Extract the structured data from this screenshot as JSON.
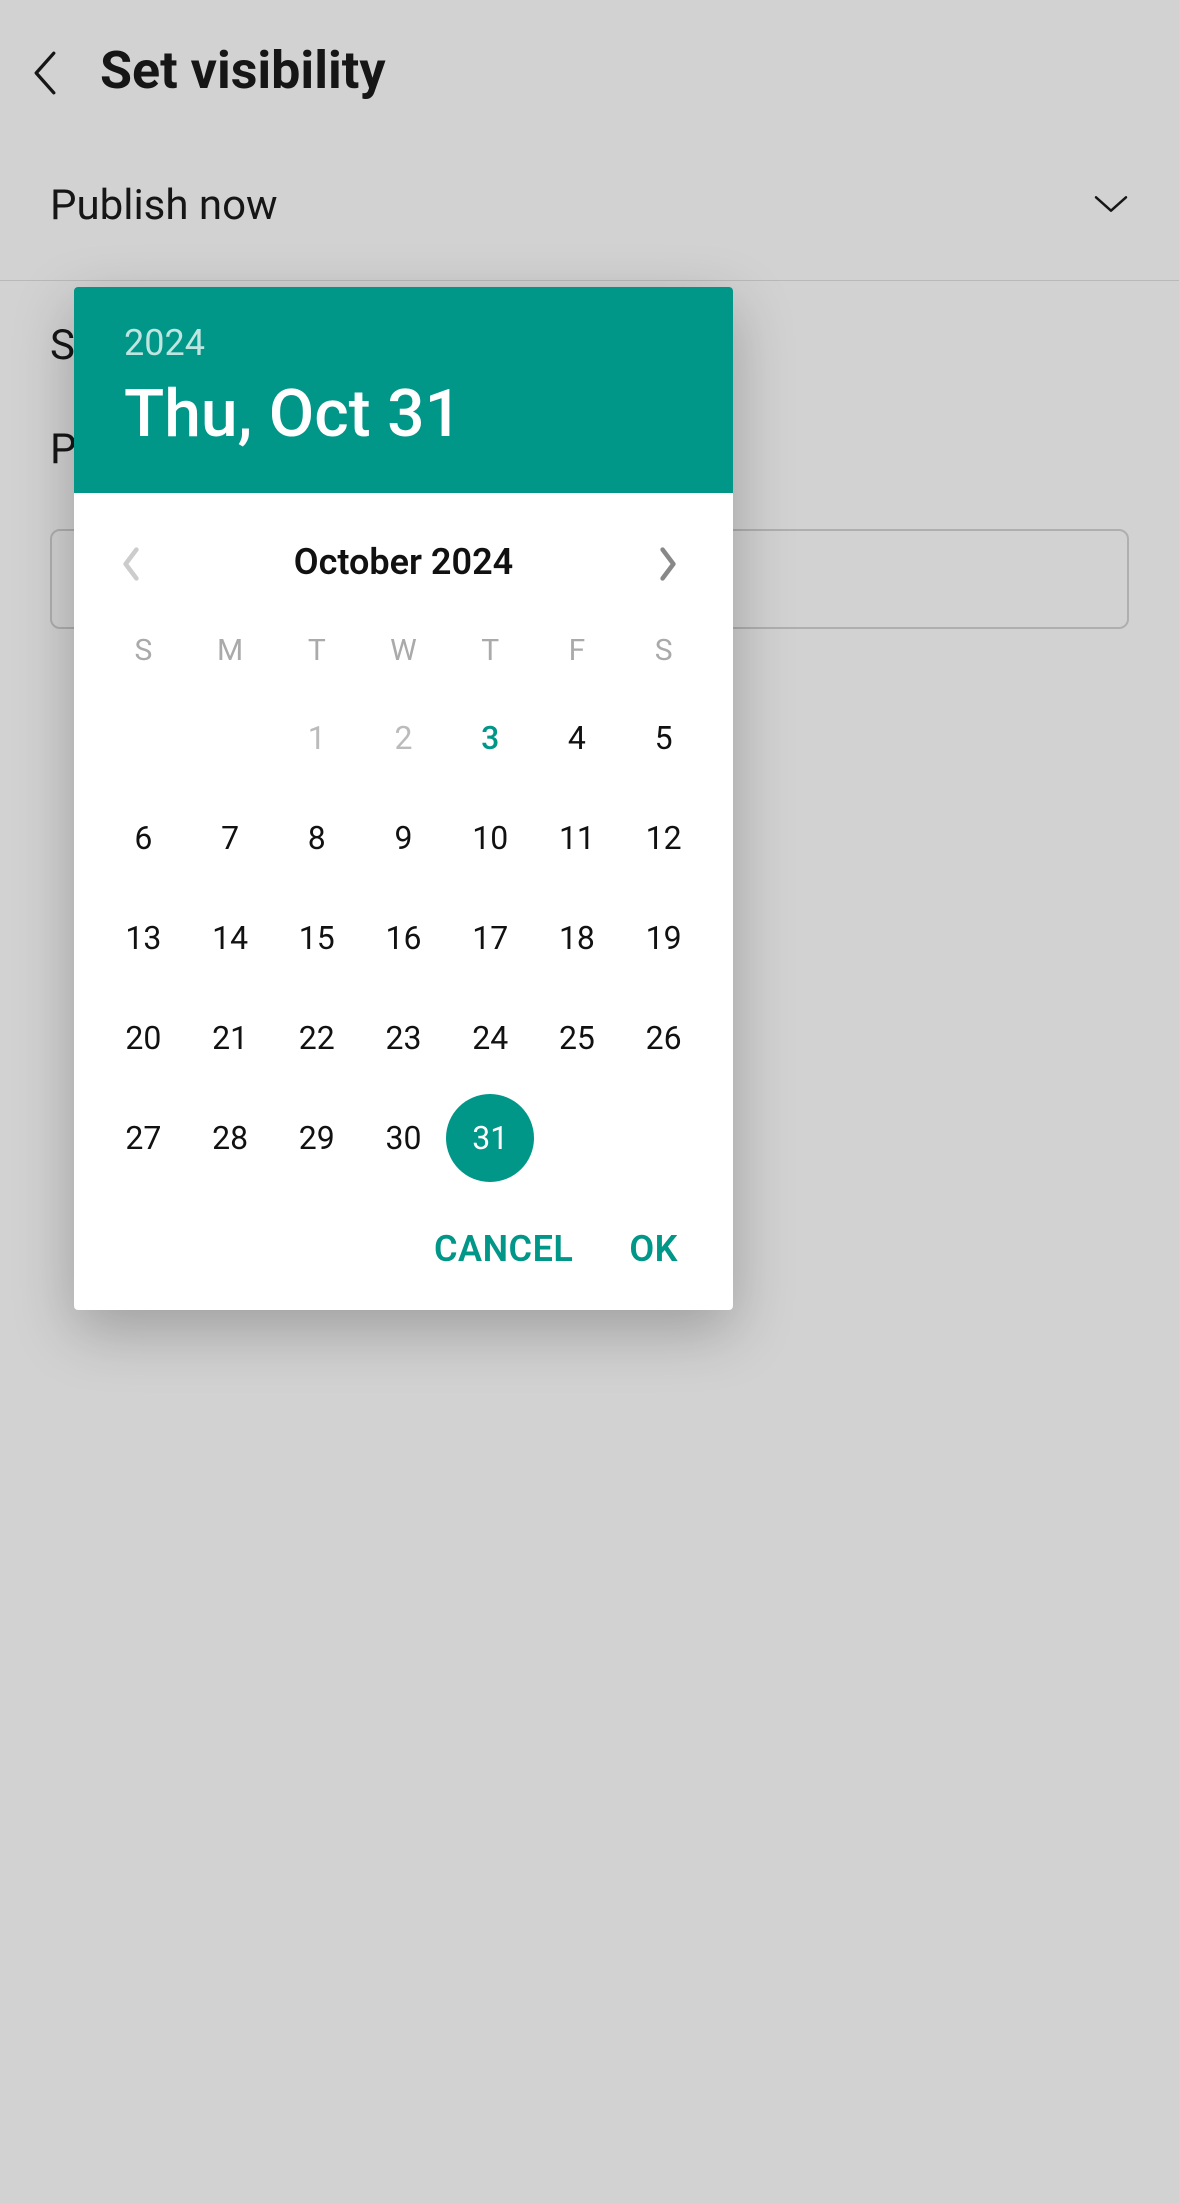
{
  "header": {
    "title": "Set visibility"
  },
  "options": {
    "publish_now": "Publish now"
  },
  "background_partials": {
    "line1": "S",
    "line2": "P"
  },
  "datepicker": {
    "year": "2024",
    "selected_date_label": "Thu, Oct 31",
    "month_label": "October 2024",
    "weekdays": [
      "S",
      "M",
      "T",
      "W",
      "T",
      "F",
      "S"
    ],
    "weeks": [
      [
        {
          "n": "",
          "state": "empty"
        },
        {
          "n": "",
          "state": "empty"
        },
        {
          "n": "1",
          "state": "disabled"
        },
        {
          "n": "2",
          "state": "disabled"
        },
        {
          "n": "3",
          "state": "today"
        },
        {
          "n": "4",
          "state": "normal"
        },
        {
          "n": "5",
          "state": "normal"
        }
      ],
      [
        {
          "n": "6",
          "state": "normal"
        },
        {
          "n": "7",
          "state": "normal"
        },
        {
          "n": "8",
          "state": "normal"
        },
        {
          "n": "9",
          "state": "normal"
        },
        {
          "n": "10",
          "state": "normal"
        },
        {
          "n": "11",
          "state": "normal"
        },
        {
          "n": "12",
          "state": "normal"
        }
      ],
      [
        {
          "n": "13",
          "state": "normal"
        },
        {
          "n": "14",
          "state": "normal"
        },
        {
          "n": "15",
          "state": "normal"
        },
        {
          "n": "16",
          "state": "normal"
        },
        {
          "n": "17",
          "state": "normal"
        },
        {
          "n": "18",
          "state": "normal"
        },
        {
          "n": "19",
          "state": "normal"
        }
      ],
      [
        {
          "n": "20",
          "state": "normal"
        },
        {
          "n": "21",
          "state": "normal"
        },
        {
          "n": "22",
          "state": "normal"
        },
        {
          "n": "23",
          "state": "normal"
        },
        {
          "n": "24",
          "state": "normal"
        },
        {
          "n": "25",
          "state": "normal"
        },
        {
          "n": "26",
          "state": "normal"
        }
      ],
      [
        {
          "n": "27",
          "state": "normal"
        },
        {
          "n": "28",
          "state": "normal"
        },
        {
          "n": "29",
          "state": "normal"
        },
        {
          "n": "30",
          "state": "normal"
        },
        {
          "n": "31",
          "state": "selected"
        },
        {
          "n": "",
          "state": "empty"
        },
        {
          "n": "",
          "state": "empty"
        }
      ]
    ],
    "actions": {
      "cancel": "CANCEL",
      "ok": "OK"
    }
  },
  "colors": {
    "accent": "#009688"
  }
}
